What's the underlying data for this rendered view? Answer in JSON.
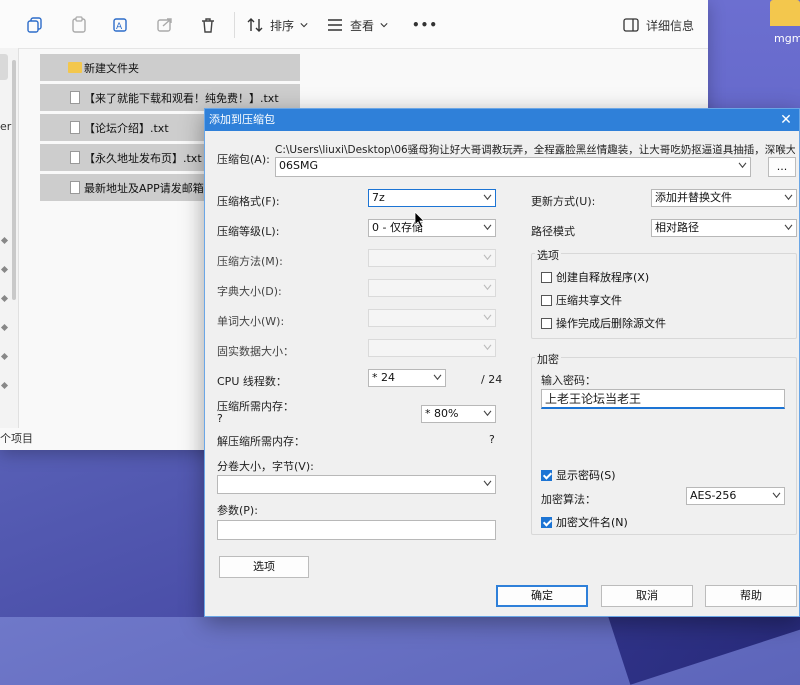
{
  "desktop": {
    "icon_label": "mgm"
  },
  "explorer": {
    "toolbar": {
      "sort_label": "排序",
      "view_label": "查看",
      "more_label": "•••",
      "details_label": "详细信息"
    },
    "left_text": "er",
    "status": "个项目",
    "files": [
      {
        "name": "新建文件夹",
        "type": "folder"
      },
      {
        "name": "【来了就能下载和观看！纯免费！】.txt",
        "type": "file"
      },
      {
        "name": "【论坛介绍】.txt",
        "type": "file"
      },
      {
        "name": "【永久地址发布页】.txt",
        "type": "file"
      },
      {
        "name": "最新地址及APP请发邮箱",
        "type": "file"
      }
    ]
  },
  "dialog": {
    "title": "添加到压缩包",
    "archive_label": "压缩包(A):",
    "archive_path_line1": "C:\\Users\\liuxi\\Desktop\\06骚母狗让好大哥调教玩弄，全程露脸黑丝情趣装，让大哥吃奶抠逼道具抽插，深喉大",
    "archive_path_line2": "06SMG",
    "browse_label": "...",
    "format_label": "压缩格式(F):",
    "format_value": "7z",
    "level_label": "压缩等级(L):",
    "level_value": "0 - 仅存储",
    "method_label": "压缩方法(M):",
    "dict_label": "字典大小(D):",
    "word_label": "单词大小(W):",
    "solid_label": "固实数据大小：",
    "cpu_label": "CPU 线程数：",
    "cpu_value": "* 24",
    "cpu_total": "/ 24",
    "mem_comp_label": "压缩所需内存：",
    "mem_comp_value": "?",
    "mem_pct_value": "* 80%",
    "mem_decomp_label": "解压缩所需内存：",
    "mem_decomp_value": "?",
    "volume_label": "分卷大小，字节(V):",
    "params_label": "参数(P):",
    "options_button": "选项",
    "update_label": "更新方式(U):",
    "update_value": "添加并替换文件",
    "path_mode_label": "路径模式",
    "path_mode_value": "相对路径",
    "options_group": "选项",
    "opt_sfx": "创建自释放程序(X)",
    "opt_shared": "压缩共享文件",
    "opt_delete": "操作完成后删除源文件",
    "encrypt_group": "加密",
    "password_label": "输入密码：",
    "password_value": "上老王论坛当老王",
    "show_password": "显示密码(S)",
    "enc_method_label": "加密算法：",
    "enc_method_value": "AES-256",
    "encrypt_names": "加密文件名(N)",
    "ok_button": "确定",
    "cancel_button": "取消",
    "help_button": "帮助"
  }
}
